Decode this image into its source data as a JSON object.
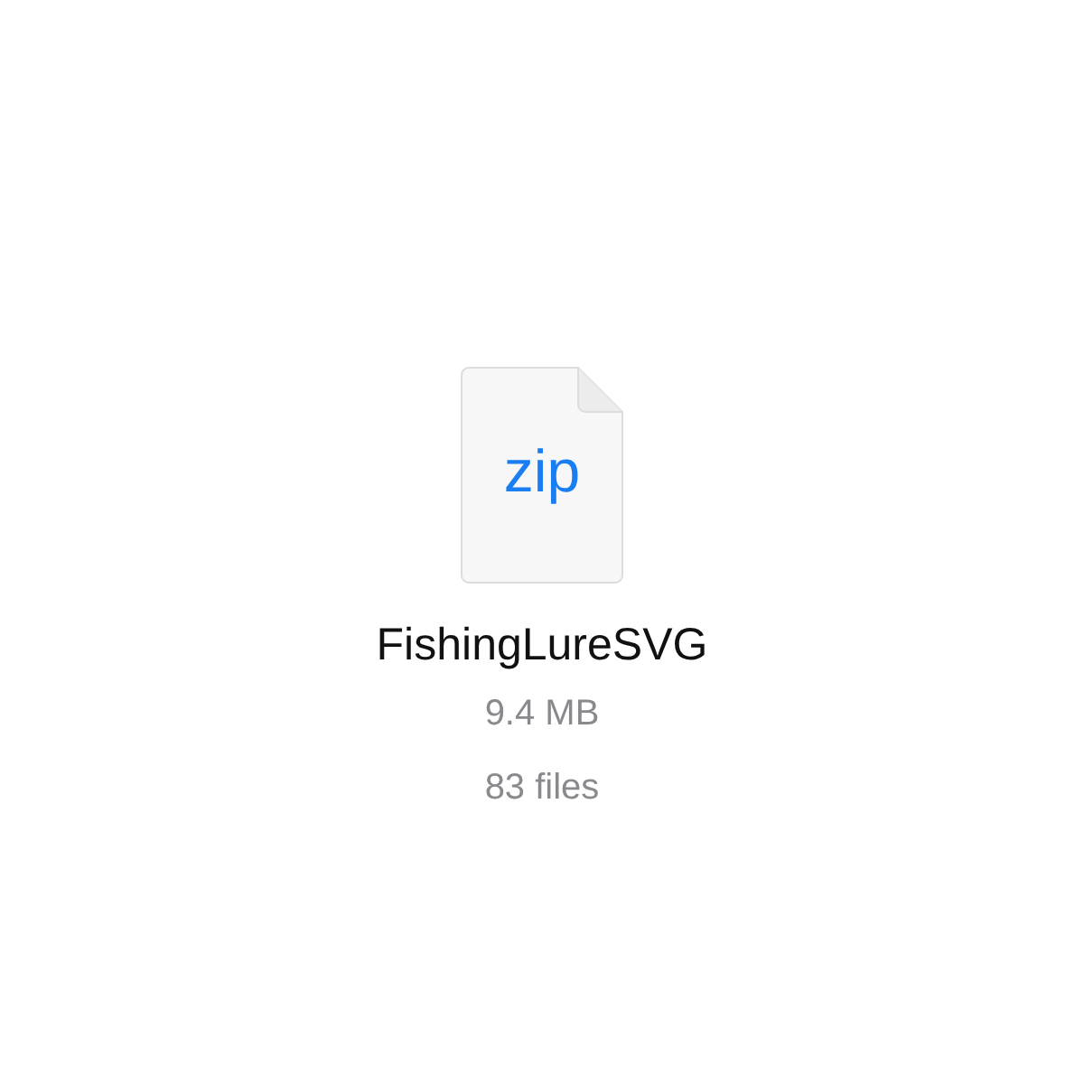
{
  "file": {
    "type_label": "zip",
    "name": "FishingLureSVG",
    "size": "9.4 MB",
    "count": "83 files"
  }
}
